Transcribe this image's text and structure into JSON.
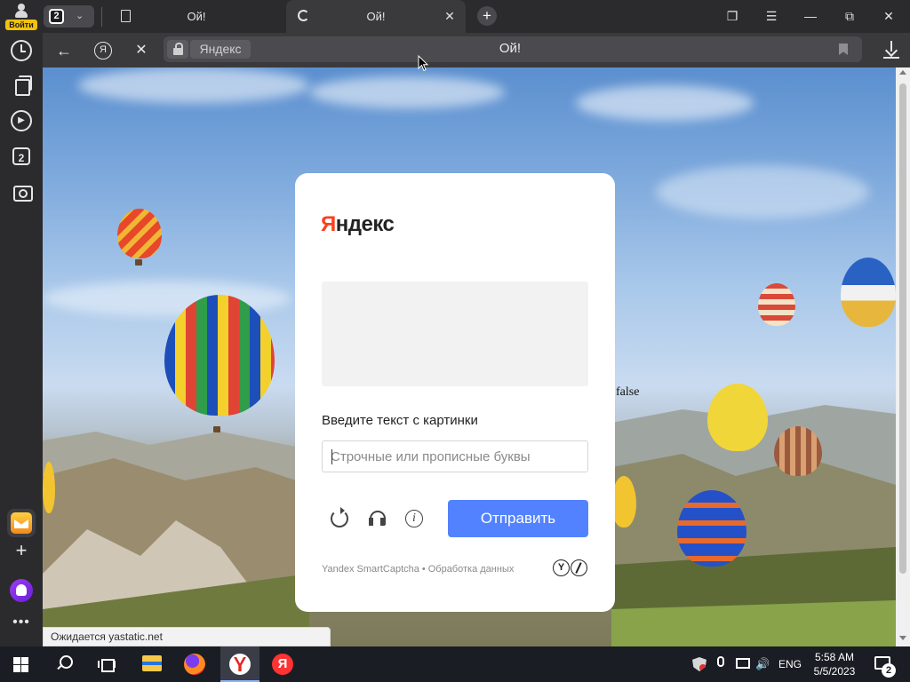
{
  "titlebar": {
    "login_label": "Войти",
    "tab_count": "2",
    "tabs": [
      {
        "title": "Ой!",
        "state": "idle",
        "icon": "document-icon"
      },
      {
        "title": "Ой!",
        "state": "loading",
        "icon": "loading-spinner-icon"
      }
    ],
    "new_tab_symbol": "+"
  },
  "toolbar": {
    "yandex_button_glyph": "Я",
    "domain_chip": "Яндекс",
    "page_title": "Ой!"
  },
  "sidebar": {
    "tabs_count": "2",
    "items": [
      "history-icon",
      "collections-icon",
      "video-icon",
      "tabs-icon",
      "screenshot-icon",
      "mail-icon",
      "add-icon",
      "alice-icon",
      "more-icon"
    ]
  },
  "page": {
    "stray_text": "false",
    "captcha": {
      "logo_first": "Я",
      "logo_rest": "ндекс",
      "prompt": "Введите текст с картинки",
      "input_value": "",
      "input_placeholder": "Строчные или прописные буквы",
      "submit_label": "Отправить",
      "footer_brand": "Yandex SmartCaptcha",
      "footer_separator": "•",
      "footer_link": "Обработка данных",
      "footer_logo_letter": "Y"
    }
  },
  "status_bar": {
    "text": "Ожидается yastatic.net"
  },
  "taskbar": {
    "yandex_app_glyph": "Я",
    "language": "ENG",
    "time": "5:58 AM",
    "date": "5/5/2023",
    "notification_count": "2"
  },
  "colors": {
    "browser_chrome": "#2b2b2e",
    "toolbar": "#3a3a3d",
    "yandex_red": "#fc3f1d",
    "submit_blue": "#5282ff",
    "login_badge": "#f4c20d"
  }
}
